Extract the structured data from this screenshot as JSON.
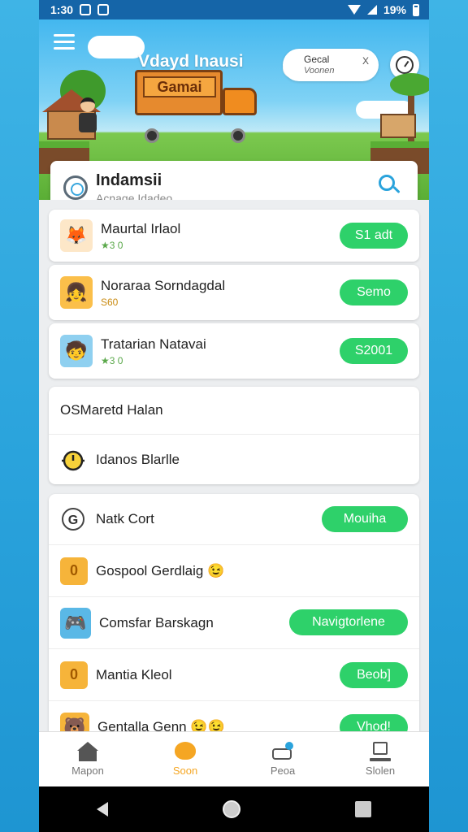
{
  "status_bar": {
    "time": "1:30",
    "battery": "19%"
  },
  "header": {
    "title": "Vdayd Inausi",
    "bubble": {
      "line1": "Gecal",
      "line2": "Voonen",
      "close": "X"
    },
    "truck_sign": "Gamai"
  },
  "search_card": {
    "title": "Indamsii",
    "subtitle": "Acnage Idadeo"
  },
  "featured": [
    {
      "title": "Maurtal Irlaol",
      "sub": "★3 0",
      "button": "S1 adt",
      "icon": "fox-avatar-icon",
      "icon_glyph": "🦊",
      "icon_bg": "#fde7c8"
    },
    {
      "title": "Noraraa Sorndagdal",
      "sub": "S60",
      "button": "Semo",
      "icon": "girl-avatar-icon",
      "icon_glyph": "👧",
      "icon_bg": "#fbbf4a"
    },
    {
      "title": "Tratarian Natavai",
      "sub": "★3 0",
      "button": "S2001",
      "icon": "kid-avatar-icon",
      "icon_glyph": "🧒",
      "icon_bg": "#8fd0f0"
    }
  ],
  "section2": [
    {
      "title": "OSMaretd Halan",
      "icon": ""
    },
    {
      "title": "Idanos Blarlle",
      "icon": "timer-icon"
    }
  ],
  "section3": [
    {
      "title": "Natk Cort",
      "button": "Mouiha",
      "icon": "g-logo-icon",
      "glyph": "G",
      "bg": "#ffffff"
    },
    {
      "title": "Gospool Gerdlaig 😉",
      "button": "",
      "icon": "coin-icon",
      "glyph": "0",
      "bg": "#f6b43a"
    },
    {
      "title": "Comsfar Barskagn",
      "button": "Navigtorlene",
      "icon": "game-avatar-icon",
      "glyph": "🎮",
      "bg": "#5ab8e6"
    },
    {
      "title": "Mantia Kleol",
      "button": "Beob]",
      "icon": "gold-coin-icon",
      "glyph": "0",
      "bg": "#f6b43a"
    },
    {
      "title": "Gentalla Genn 😉😉",
      "button": "Vhod!",
      "icon": "bear-avatar-icon",
      "glyph": "🐻",
      "bg": "#f6b43a"
    }
  ],
  "bottom_nav": [
    {
      "label": "Mapon",
      "icon": "home-icon",
      "active": false
    },
    {
      "label": "Soon",
      "icon": "game-icon",
      "active": true
    },
    {
      "label": "Peoa",
      "icon": "camera-icon",
      "active": false
    },
    {
      "label": "Slolen",
      "icon": "laptop-icon",
      "active": false
    }
  ],
  "colors": {
    "accent": "#2ed16a",
    "statusbar": "#1565a8",
    "active_tab": "#f5a623",
    "link_blue": "#2aa3dc"
  }
}
